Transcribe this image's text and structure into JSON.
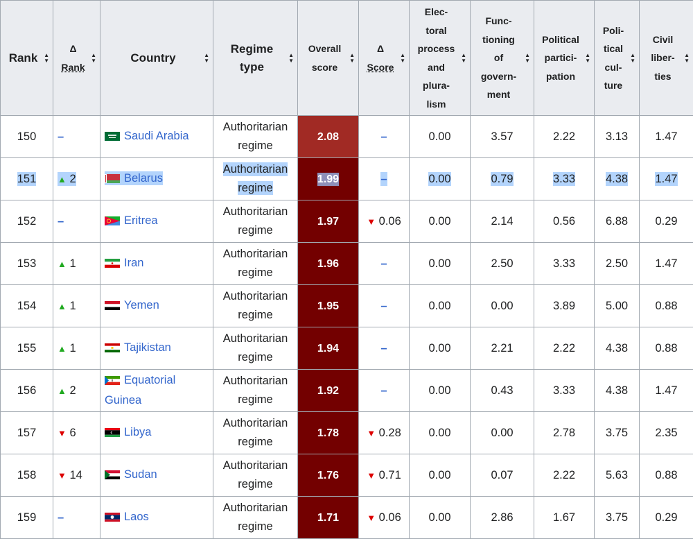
{
  "headers": {
    "rank": "Rank",
    "delta_rank_symbol": "Δ",
    "delta_rank_label": "Rank",
    "country": "Country",
    "regime_type_l1": "Regime",
    "regime_type_l2": "type",
    "overall_l1": "Overall",
    "overall_l2": "score",
    "delta_score_symbol": "Δ",
    "delta_score_label": "Score",
    "electoral": [
      "Elec-",
      "toral",
      "process",
      "and",
      "plura-",
      "lism"
    ],
    "functioning": [
      "Func-",
      "tioning",
      "of",
      "govern-",
      "ment"
    ],
    "participation": [
      "Political",
      "partici-",
      "pation"
    ],
    "culture": [
      "Poli-",
      "tical",
      "cul-",
      "ture"
    ],
    "liberties": [
      "Civil",
      "liber-",
      "ties"
    ]
  },
  "colors": {
    "header_bg": "#eaecf0",
    "border": "#a2a9b1",
    "link": "#3366cc",
    "selection": "#b3d4fc",
    "score_dark": "#730000",
    "score_saudi": "#a12a24",
    "up": "#22aa22",
    "down": "#dd0000"
  },
  "rows": [
    {
      "rank": "150",
      "delta_dir": "none",
      "delta_rank": "",
      "country": "Saudi Arabia",
      "flag": "saudi",
      "regime_l1": "Authoritarian",
      "regime_l2": "regime",
      "overall": "2.08",
      "score_color": "#a12a24",
      "delta_score_dir": "none",
      "delta_score": "",
      "electoral": "0.00",
      "functioning": "3.57",
      "participation": "2.22",
      "culture": "3.13",
      "liberties": "1.47",
      "selected": false
    },
    {
      "rank": "151",
      "delta_dir": "up",
      "delta_rank": "2",
      "country": "Belarus",
      "flag": "belarus",
      "regime_l1": "Authoritarian",
      "regime_l2": "regime",
      "overall": "1.99",
      "score_color": "#730000",
      "delta_score_dir": "none",
      "delta_score": "",
      "electoral": "0.00",
      "functioning": "0.79",
      "participation": "3.33",
      "culture": "4.38",
      "liberties": "1.47",
      "selected": true
    },
    {
      "rank": "152",
      "delta_dir": "none",
      "delta_rank": "",
      "country": "Eritrea",
      "flag": "eritrea",
      "regime_l1": "Authoritarian",
      "regime_l2": "regime",
      "overall": "1.97",
      "score_color": "#730000",
      "delta_score_dir": "down",
      "delta_score": "0.06",
      "electoral": "0.00",
      "functioning": "2.14",
      "participation": "0.56",
      "culture": "6.88",
      "liberties": "0.29",
      "selected": false
    },
    {
      "rank": "153",
      "delta_dir": "up",
      "delta_rank": "1",
      "country": "Iran",
      "flag": "iran",
      "regime_l1": "Authoritarian",
      "regime_l2": "regime",
      "overall": "1.96",
      "score_color": "#730000",
      "delta_score_dir": "none",
      "delta_score": "",
      "electoral": "0.00",
      "functioning": "2.50",
      "participation": "3.33",
      "culture": "2.50",
      "liberties": "1.47",
      "selected": false
    },
    {
      "rank": "154",
      "delta_dir": "up",
      "delta_rank": "1",
      "country": "Yemen",
      "flag": "yemen",
      "regime_l1": "Authoritarian",
      "regime_l2": "regime",
      "overall": "1.95",
      "score_color": "#730000",
      "delta_score_dir": "none",
      "delta_score": "",
      "electoral": "0.00",
      "functioning": "0.00",
      "participation": "3.89",
      "culture": "5.00",
      "liberties": "0.88",
      "selected": false
    },
    {
      "rank": "155",
      "delta_dir": "up",
      "delta_rank": "1",
      "country": "Tajikistan",
      "flag": "tajikistan",
      "regime_l1": "Authoritarian",
      "regime_l2": "regime",
      "overall": "1.94",
      "score_color": "#730000",
      "delta_score_dir": "none",
      "delta_score": "",
      "electoral": "0.00",
      "functioning": "2.21",
      "participation": "2.22",
      "culture": "4.38",
      "liberties": "0.88",
      "selected": false
    },
    {
      "rank": "156",
      "delta_dir": "up",
      "delta_rank": "2",
      "country": "Equatorial Guinea",
      "flag": "eqguinea",
      "regime_l1": "Authoritarian",
      "regime_l2": "regime",
      "overall": "1.92",
      "score_color": "#730000",
      "delta_score_dir": "none",
      "delta_score": "",
      "electoral": "0.00",
      "functioning": "0.43",
      "participation": "3.33",
      "culture": "4.38",
      "liberties": "1.47",
      "selected": false
    },
    {
      "rank": "157",
      "delta_dir": "down",
      "delta_rank": "6",
      "country": "Libya",
      "flag": "libya",
      "regime_l1": "Authoritarian",
      "regime_l2": "regime",
      "overall": "1.78",
      "score_color": "#730000",
      "delta_score_dir": "down",
      "delta_score": "0.28",
      "electoral": "0.00",
      "functioning": "0.00",
      "participation": "2.78",
      "culture": "3.75",
      "liberties": "2.35",
      "selected": false
    },
    {
      "rank": "158",
      "delta_dir": "down",
      "delta_rank": "14",
      "country": "Sudan",
      "flag": "sudan",
      "regime_l1": "Authoritarian",
      "regime_l2": "regime",
      "overall": "1.76",
      "score_color": "#730000",
      "delta_score_dir": "down",
      "delta_score": "0.71",
      "electoral": "0.00",
      "functioning": "0.07",
      "participation": "2.22",
      "culture": "5.63",
      "liberties": "0.88",
      "selected": false
    },
    {
      "rank": "159",
      "delta_dir": "none",
      "delta_rank": "",
      "country": "Laos",
      "flag": "laos",
      "regime_l1": "Authoritarian",
      "regime_l2": "regime",
      "overall": "1.71",
      "score_color": "#730000",
      "delta_score_dir": "down",
      "delta_score": "0.06",
      "electoral": "0.00",
      "functioning": "2.86",
      "participation": "1.67",
      "culture": "3.75",
      "liberties": "0.29",
      "selected": false
    }
  ]
}
